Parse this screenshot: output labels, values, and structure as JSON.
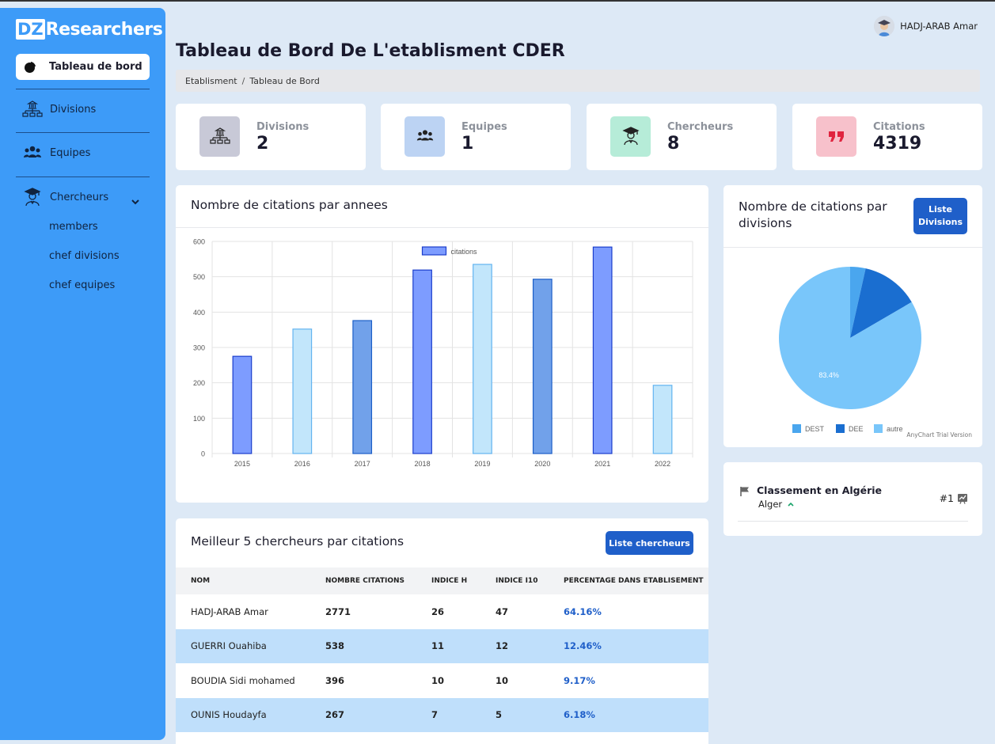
{
  "app": {
    "logo_box": "DZ",
    "logo_text": "Researchers"
  },
  "sidebar": {
    "active": "Tableau de bord",
    "items": [
      {
        "label": "Divisions"
      },
      {
        "label": "Equipes"
      },
      {
        "label": "Chercheurs"
      }
    ],
    "sub_items": [
      "members",
      "chef divisions",
      "chef equipes"
    ]
  },
  "header": {
    "user_name": "HADJ-ARAB Amar"
  },
  "page": {
    "title": "Tableau de Bord De L'etablisment CDER",
    "breadcrumb": [
      "Etablisment",
      "/",
      "Tableau de Bord"
    ]
  },
  "stats": [
    {
      "label": "Divisions",
      "value": "2",
      "color": "#c8c9d7"
    },
    {
      "label": "Equipes",
      "value": "1",
      "color": "#bcd3f3"
    },
    {
      "label": "Chercheurs",
      "value": "8",
      "color": "#b6ecd8"
    },
    {
      "label": "Citations",
      "value": "4319",
      "color": "#f7c1cb"
    }
  ],
  "bar_card": {
    "title": "Nombre de citations par annees"
  },
  "pie_card": {
    "title": "Nombre de citations par divisions",
    "button": "Liste Divisions",
    "trial": "AnyChart Trial Version"
  },
  "rank_card": {
    "title": "Classement en Algérie",
    "city": "Alger",
    "rank": "#1"
  },
  "table_card": {
    "title": "Meilleur 5 chercheurs par citations",
    "button": "Liste chercheurs",
    "columns": [
      "NOM",
      "NOMBRE CITATIONS",
      "INDICE H",
      "INDICE I10",
      "PERCENTAGE DANS ETABLISEMENT"
    ],
    "rows": [
      [
        "HADJ-ARAB Amar",
        "2771",
        "26",
        "47",
        "64.16%"
      ],
      [
        "GUERRI Ouahiba",
        "538",
        "11",
        "12",
        "12.46%"
      ],
      [
        "BOUDIA Sidi mohamed",
        "396",
        "10",
        "10",
        "9.17%"
      ],
      [
        "OUNIS Houdayfa",
        "267",
        "7",
        "5",
        "6.18%"
      ]
    ]
  },
  "chart_data": [
    {
      "type": "bar",
      "title": "Nombre de citations par annees",
      "categories": [
        "2015",
        "2016",
        "2017",
        "2018",
        "2019",
        "2020",
        "2021",
        "2022"
      ],
      "series": [
        {
          "name": "citations",
          "values": [
            275,
            352,
            376,
            519,
            535,
            493,
            584,
            193
          ]
        }
      ],
      "ylim": [
        0,
        600
      ],
      "yticks": [
        "0",
        "100",
        "200",
        "300",
        "400",
        "500",
        "600"
      ],
      "grid": true,
      "legend": "top-center",
      "colors": [
        "#7d9cff",
        "#c2e6fb",
        "#71a1ea",
        "#7d9cff",
        "#c2e6fb",
        "#71a1ea",
        "#7d9cff",
        "#c2e6fb"
      ],
      "borders": [
        "#1b3ecc",
        "#63b4f0",
        "#1b5ec7",
        "#1b3ecc",
        "#63b4f0",
        "#1b5ec7",
        "#1b3ecc",
        "#63b4f0"
      ]
    },
    {
      "type": "pie",
      "title": "Nombre de citations par divisions",
      "labels": [
        "DEST",
        "DEE",
        "autre"
      ],
      "values": [
        3.5,
        13.1,
        83.4
      ],
      "data_labels": [
        "",
        "",
        "83.4%"
      ],
      "colors": [
        "#4aa6ee",
        "#1a6ed0",
        "#79c6fa"
      ],
      "legend": "bottom"
    }
  ]
}
